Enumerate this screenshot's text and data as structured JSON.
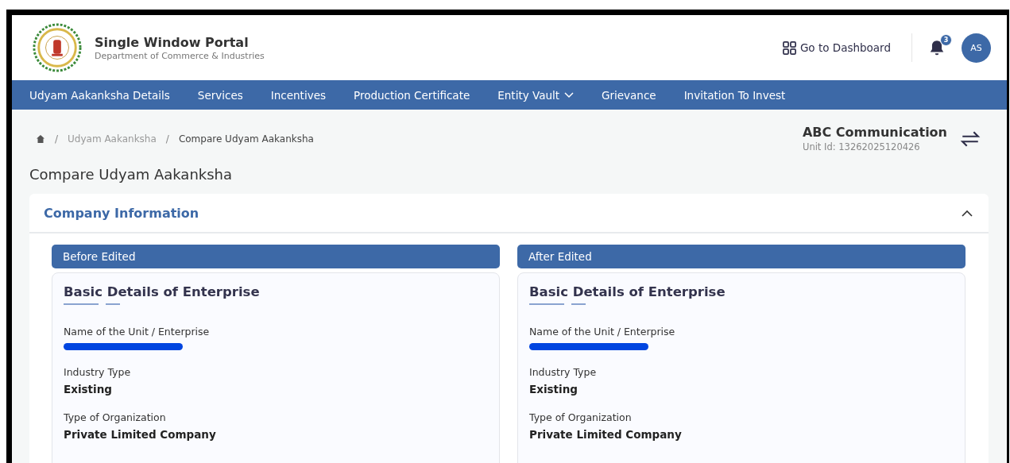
{
  "header": {
    "title": "Single Window Portal",
    "subtitle": "Department of Commerce & Industries",
    "dashboard_link": "Go to Dashboard",
    "notification_count": "3",
    "avatar": "AS"
  },
  "nav": [
    {
      "label": "Udyam Aakanksha Details",
      "dropdown": false
    },
    {
      "label": "Services",
      "dropdown": false
    },
    {
      "label": "Incentives",
      "dropdown": false
    },
    {
      "label": "Production Certificate",
      "dropdown": false
    },
    {
      "label": "Entity Vault",
      "dropdown": true
    },
    {
      "label": "Grievance",
      "dropdown": false
    },
    {
      "label": "Invitation To Invest",
      "dropdown": false
    }
  ],
  "breadcrumb": [
    {
      "separator": "/",
      "label": "Udyam Aakanksha"
    },
    {
      "separator": "/",
      "label": "Compare Udyam Aakanksha"
    }
  ],
  "unit": {
    "name": "ABC Communication",
    "id": "Unit Id: 13262025120426"
  },
  "page_title": "Compare Udyam Aakanksha",
  "section": {
    "title": "Company Information",
    "expanded": true,
    "columns": [
      {
        "heading": "Before Edited",
        "card_title": "Basic Details of Enterprise",
        "fields": [
          {
            "label": "Name of the Unit / Enterprise",
            "kind": "redacted"
          },
          {
            "label": "Industry Type",
            "kind": "text",
            "value": "Existing"
          },
          {
            "label": "Type of Organization",
            "kind": "text",
            "value": "Private Limited Company"
          }
        ]
      },
      {
        "heading": "After Edited",
        "card_title": "Basic Details of Enterprise",
        "fields": [
          {
            "label": "Name of the Unit / Enterprise",
            "kind": "redacted"
          },
          {
            "label": "Industry Type",
            "kind": "text",
            "value": "Existing"
          },
          {
            "label": "Type of Organization",
            "kind": "text",
            "value": "Private Limited Company"
          }
        ]
      }
    ]
  }
}
